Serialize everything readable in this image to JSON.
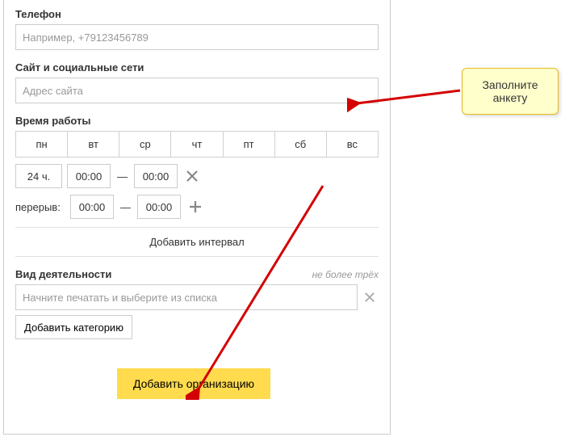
{
  "phone": {
    "label": "Телефон",
    "placeholder": "Например, +79123456789"
  },
  "site": {
    "label": "Сайт и социальные сети",
    "placeholder": "Адрес сайта"
  },
  "hours": {
    "label": "Время работы",
    "days": [
      "пн",
      "вт",
      "ср",
      "чт",
      "пт",
      "сб",
      "вс"
    ],
    "full_day": "24 ч.",
    "time_from": "00:00",
    "time_to": "00:00",
    "break_label": "перерыв:",
    "break_from": "00:00",
    "break_to": "00:00",
    "add_interval": "Добавить интервал"
  },
  "activity": {
    "label": "Вид деятельности",
    "hint": "не более трёх",
    "placeholder": "Начните печатать и выберите из списка",
    "add_category": "Добавить категорию"
  },
  "submit": "Добавить организацию",
  "callout": {
    "line1": "Заполните",
    "line2": "анкету"
  }
}
